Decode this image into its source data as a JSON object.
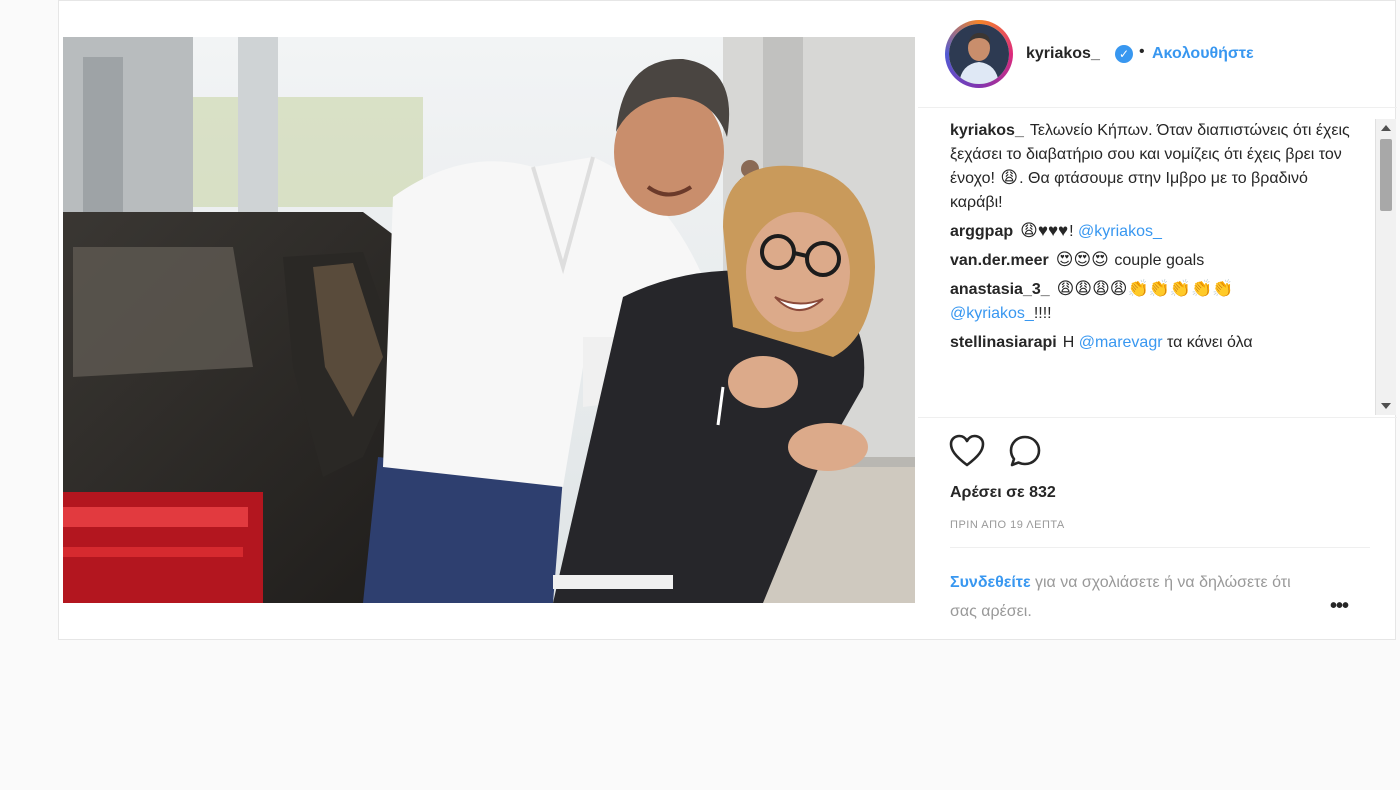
{
  "post": {
    "username": "kyriakos_",
    "follow_label": "Ακολουθήστε",
    "separator": "•",
    "verified_icon": "verified-check-icon",
    "likes_text": "Αρέσει σε 832",
    "timestamp": "ΠΡΙΝ ΑΠΟ 19 ΛΕΠΤΑ",
    "caption": {
      "user": "kyriakos_",
      "text_before_emoji": "Τελωνείο Κήπων. Όταν διαπιστώνεις ότι έχεις ξεχάσει το διαβατήριο σου και νομίζεις ότι έχεις βρει τον ένοχο!",
      "emoji": "😩",
      "text_after_emoji": ". Θα φτάσουμε στην Ιμβρο με το βραδινό καράβι!"
    },
    "comments": [
      {
        "user": "arggpap",
        "emoji": "😩♥♥♥",
        "text": "!",
        "mention": "@kyriakos_"
      },
      {
        "user": "van.der.meer",
        "emoji": "😍😍😍",
        "text": "couple goals"
      },
      {
        "user": "anastasia_3_",
        "emoji": "😩😩😩😩👏👏👏👏👏",
        "mention": "@kyriakos_",
        "text": "!!!!"
      },
      {
        "user": "stellinasiarapi",
        "text_before": "Η",
        "mention": "@marevagr",
        "text": "τα κάνει όλα"
      }
    ],
    "footer": {
      "login_link": "Συνδεθείτε",
      "login_text": "για να σχολιάσετε ή να δηλώσετε ότι σας αρέσει.",
      "more_label": "•••"
    },
    "colors": {
      "link_blue": "#3897f0",
      "text_dark": "#262626",
      "text_muted": "#999999",
      "border": "#efefef"
    },
    "icons": [
      "heart-icon",
      "comment-bubble-icon",
      "more-options-icon",
      "verified-check-icon"
    ]
  }
}
